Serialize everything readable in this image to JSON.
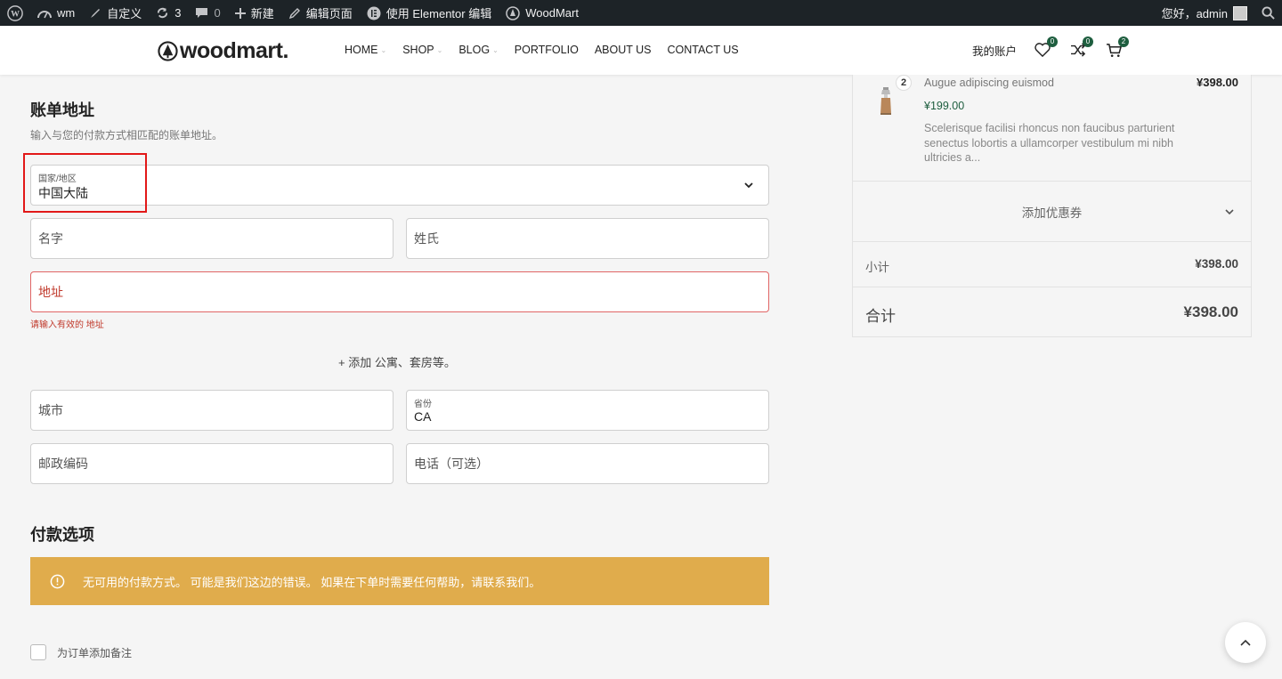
{
  "adminbar": {
    "site": "wm",
    "customize": "自定义",
    "updates": "3",
    "comments": "0",
    "new": "新建",
    "edit_page": "编辑页面",
    "elementor": "使用 Elementor 编辑",
    "theme": "WoodMart",
    "greeting": "您好，admin"
  },
  "header": {
    "logo": "woodmart.",
    "nav": [
      {
        "label": "HOME"
      },
      {
        "label": "SHOP"
      },
      {
        "label": "BLOG"
      },
      {
        "label": "PORTFOLIO"
      },
      {
        "label": "ABOUT US"
      },
      {
        "label": "CONTACT US"
      }
    ],
    "account": "我的账户",
    "wishlist_count": "0",
    "compare_count": "0",
    "cart_count": "2"
  },
  "billing": {
    "title": "账单地址",
    "subtitle": "输入与您的付款方式相匹配的账单地址。",
    "country_label": "国家/地区",
    "country_value": "中国大陆",
    "first_name": "名字",
    "last_name": "姓氏",
    "address": "地址",
    "address_error": "请输入有效的 地址",
    "add_apartment": "+ 添加 公寓、套房等。",
    "city": "城市",
    "state_label": "省份",
    "state_value": "CA",
    "postcode": "邮政编码",
    "phone": "电话（可选）"
  },
  "payment": {
    "title": "付款选项",
    "notice": "无可用的付款方式。 可能是我们这边的错误。 如果在下单时需要任何帮助，请联系我们。",
    "order_note": "为订单添加备注"
  },
  "summary": {
    "qty": "2",
    "product_name": "Augue adipiscing euismod",
    "product_total": "¥398.00",
    "product_price": "¥199.00",
    "product_desc": "Scelerisque facilisi rhoncus non faucibus parturient senectus lobortis a ullamcorper vestibulum mi nibh ultricies a...",
    "coupon": "添加优惠券",
    "subtotal_label": "小计",
    "subtotal_value": "¥398.00",
    "total_label": "合计",
    "total_value": "¥398.00"
  },
  "colors": {
    "accent_green": "#1e5e3f",
    "notice_yellow": "#e0ac4c",
    "error_red": "#c0392b",
    "highlight_red": "#e21818"
  }
}
